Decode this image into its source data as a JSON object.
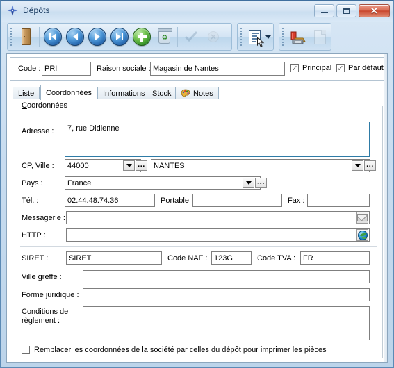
{
  "window": {
    "title": "Dépôts",
    "app_icon": "compass-icon",
    "minimize_label": "—",
    "maximize_label": "□",
    "close_label": "✕"
  },
  "toolbar": {
    "groups": [
      {
        "name": "navigation-group",
        "buttons": [
          {
            "name": "exit-button",
            "icon": "door-icon",
            "label": "Quitter",
            "enabled": true
          },
          {
            "name": "first-record-button",
            "icon": "first-record-icon",
            "label": "Premier",
            "enabled": true
          },
          {
            "name": "previous-record-button",
            "icon": "previous-record-icon",
            "label": "Précédent",
            "enabled": true
          },
          {
            "name": "next-record-button",
            "icon": "next-record-icon",
            "label": "Suivant",
            "enabled": true
          },
          {
            "name": "last-record-button",
            "icon": "last-record-icon",
            "label": "Dernier",
            "enabled": true
          },
          {
            "name": "add-record-button",
            "icon": "plus-icon",
            "label": "Ajouter",
            "enabled": true
          },
          {
            "name": "delete-record-button",
            "icon": "trash-icon",
            "label": "Supprimer",
            "enabled": true
          },
          {
            "name": "validate-button",
            "icon": "check-icon",
            "label": "Valider",
            "enabled": false
          },
          {
            "name": "cancel-button",
            "icon": "cancel-icon",
            "label": "Annuler",
            "enabled": false
          }
        ]
      },
      {
        "name": "list-group",
        "buttons": [
          {
            "name": "list-button",
            "icon": "document-list-icon",
            "label": "Liste",
            "enabled": true,
            "has_dropdown": true
          }
        ]
      },
      {
        "name": "print-group",
        "buttons": [
          {
            "name": "print-button",
            "icon": "printer-icon",
            "label": "Imprimer",
            "enabled": true
          },
          {
            "name": "preview-button",
            "icon": "page-preview-icon",
            "label": "Aperçu",
            "enabled": false
          }
        ]
      }
    ]
  },
  "header": {
    "code_label": "Code :",
    "code_value": "PRI",
    "raison_label": "Raison sociale :",
    "raison_value": "Magasin de Nantes",
    "principal_label": "Principal",
    "principal_checked": true,
    "par_defaut_label": "Par défaut",
    "par_defaut_checked": true
  },
  "tabs": {
    "items": [
      {
        "name": "tab-liste",
        "label": "Liste",
        "active": false,
        "icon": null
      },
      {
        "name": "tab-coordonnees",
        "label": "Coordonnées",
        "active": true,
        "icon": null
      },
      {
        "name": "tab-informations",
        "label": "Informations",
        "active": false,
        "icon": null
      },
      {
        "name": "tab-stock",
        "label": "Stock",
        "active": false,
        "icon": null
      },
      {
        "name": "tab-notes",
        "label": "Notes",
        "active": false,
        "icon": "palette-icon"
      }
    ]
  },
  "coordonnees": {
    "group_title_prefix": "C",
    "group_title_rest": "oordonnées",
    "adresse_label": "Adresse :",
    "adresse_value": "7, rue Didienne",
    "cp_ville_label": "CP, Ville :",
    "cp_value": "44000",
    "ville_value": "NANTES",
    "pays_label": "Pays :",
    "pays_value": "France",
    "tel_label": "Tél. :",
    "tel_value": "02.44.48.74.36",
    "portable_label": "Portable :",
    "portable_value": "",
    "fax_label": "Fax :",
    "fax_value": "",
    "messagerie_label": "Messagerie :",
    "messagerie_value": "",
    "messagerie_icon": "envelope-icon",
    "http_label": "HTTP :",
    "http_value": "",
    "http_icon": "globe-icon",
    "siret_label": "SIRET :",
    "siret_value": "SIRET",
    "code_naf_label": "Code NAF :",
    "code_naf_value": "123G",
    "code_tva_label": "Code TVA :",
    "code_tva_value": "FR",
    "ville_greffe_label_a": "Ville ",
    "ville_greffe_label_u": "g",
    "ville_greffe_label_b": "reffe :",
    "ville_greffe_value": "",
    "forme_juridique_label": "Forme juridique :",
    "forme_juridique_value": "",
    "conditions_label_line1": "Conditions de",
    "conditions_label_line2": "règlement :",
    "conditions_value": "",
    "remplacer_label": "Remplacer les coordonnées de la société par celles du dépôt pour imprimer les pièces",
    "remplacer_checked": false,
    "ellipsis_label": "..."
  },
  "colors": {
    "accent": "#2e7ba6",
    "title_text": "#14365c",
    "close_red": "#c8452c",
    "field_border": "#7f7f7f"
  }
}
